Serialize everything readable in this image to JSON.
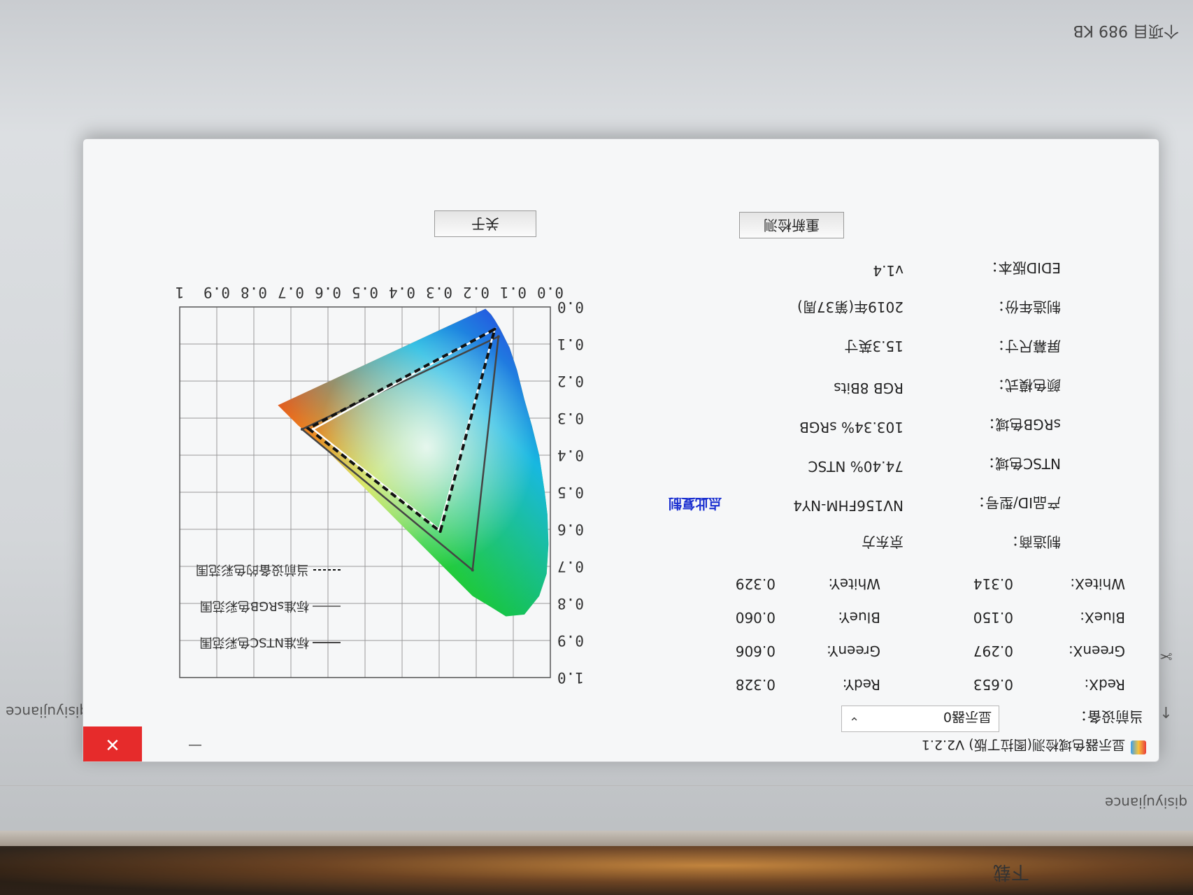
{
  "background": {
    "explorer_status": "个项目 989 KB",
    "download_label": "下载",
    "user_folder": "qisiyujiance"
  },
  "window": {
    "title": "显示器色域检测(图拉丁版) V2.2.1",
    "close_symbol": "✕"
  },
  "device": {
    "label": "当前设备：",
    "selected": "显示器0",
    "chevron": "⌄"
  },
  "chromaticity": {
    "redx_label": "RedX:",
    "redx": "0.653",
    "redy_label": "RedY:",
    "redy": "0.328",
    "greenx_label": "GreenX:",
    "greenx": "0.297",
    "greeny_label": "GreenY:",
    "greeny": "0.606",
    "bluex_label": "BlueX:",
    "bluex": "0.150",
    "bluey_label": "BlueY:",
    "bluey": "0.060",
    "whitex_label": "WhiteX:",
    "whitex": "0.314",
    "whitey_label": "WhiteY:",
    "whitey": "0.329"
  },
  "info": {
    "maker_label": "制造商：",
    "maker": "京东方",
    "product_label": "产品ID/型号：",
    "product": "NV156FHM-NY4",
    "copy_link": "点此复制",
    "ntsc_label": "NTSC色域：",
    "ntsc": "74.40% NTSC",
    "srgb_label": "sRGB色域：",
    "srgb": "103.34% sRGB",
    "color_label": "颜色模式：",
    "color": "RGB 8Bits",
    "size_label": "屏幕尺寸：",
    "size": "15.3英寸",
    "year_label": "制造年份：",
    "year": "2019年(第37周)",
    "edid_label": "EDID版本：",
    "edid": "v1.4"
  },
  "buttons": {
    "recheck": "重新检测",
    "about": "关于"
  },
  "chart_data": {
    "type": "scatter",
    "title": "",
    "xlim": [
      0,
      1
    ],
    "ylim": [
      0,
      1
    ],
    "x_ticks": [
      "0.0",
      "0.1",
      "0.2",
      "0.3",
      "0.4",
      "0.5",
      "0.6",
      "0.7",
      "0.8",
      "0.9",
      "1"
    ],
    "y_ticks": [
      "0.0",
      "0.1",
      "0.2",
      "0.3",
      "0.4",
      "0.5",
      "0.6",
      "0.7",
      "0.8",
      "0.9",
      "1.0"
    ],
    "grid": true,
    "legend_position": "top-right",
    "series": [
      {
        "name": "标准NTSC色彩范围",
        "style": "solid",
        "color": "#444444",
        "points": [
          [
            0.67,
            0.33
          ],
          [
            0.21,
            0.71
          ],
          [
            0.14,
            0.08
          ]
        ]
      },
      {
        "name": "标准sRGB色彩范围",
        "style": "solid",
        "color": "#ffffff",
        "points": [
          [
            0.64,
            0.33
          ],
          [
            0.3,
            0.6
          ],
          [
            0.15,
            0.06
          ]
        ]
      },
      {
        "name": "当前设备的色彩范围",
        "style": "dashed",
        "color": "#111111",
        "points": [
          [
            0.653,
            0.328
          ],
          [
            0.297,
            0.606
          ],
          [
            0.15,
            0.06
          ]
        ]
      }
    ]
  }
}
